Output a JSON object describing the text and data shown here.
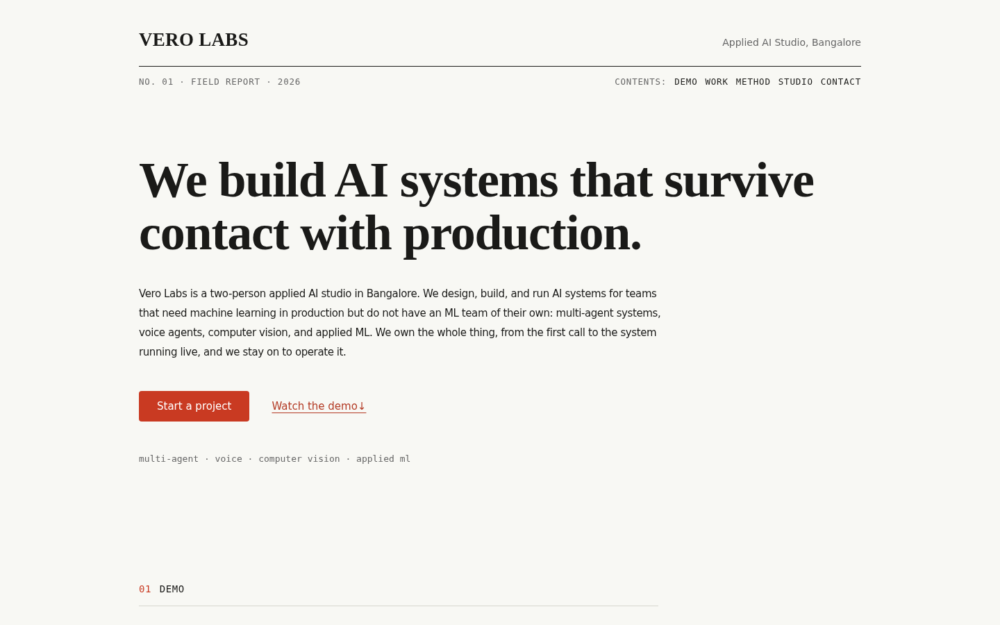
{
  "header": {
    "logo": "VERO LABS",
    "tagline": "Applied AI Studio, Bangalore"
  },
  "issue_line": "NO. 01 · FIELD REPORT · 2026",
  "contents": {
    "label": "CONTENTS:",
    "links": [
      "DEMO",
      "WORK",
      "METHOD",
      "STUDIO",
      "CONTACT"
    ]
  },
  "hero": {
    "headline": "We build AI systems that survive contact with production.",
    "intro": "Vero Labs is a two-person applied AI studio in Bangalore. We design, build, and run AI systems for teams that need machine learning in production but do not have an ML team of their own: multi-agent systems, voice agents, computer vision, and applied ML. We own the whole thing, from the first call to the system running live, and we stay on to operate it.",
    "primary_button": "Start a project",
    "secondary_link": "Watch the demo↓",
    "tags": "multi-agent · voice · computer vision · applied ml"
  },
  "section": {
    "number": "01",
    "title": "DEMO"
  }
}
